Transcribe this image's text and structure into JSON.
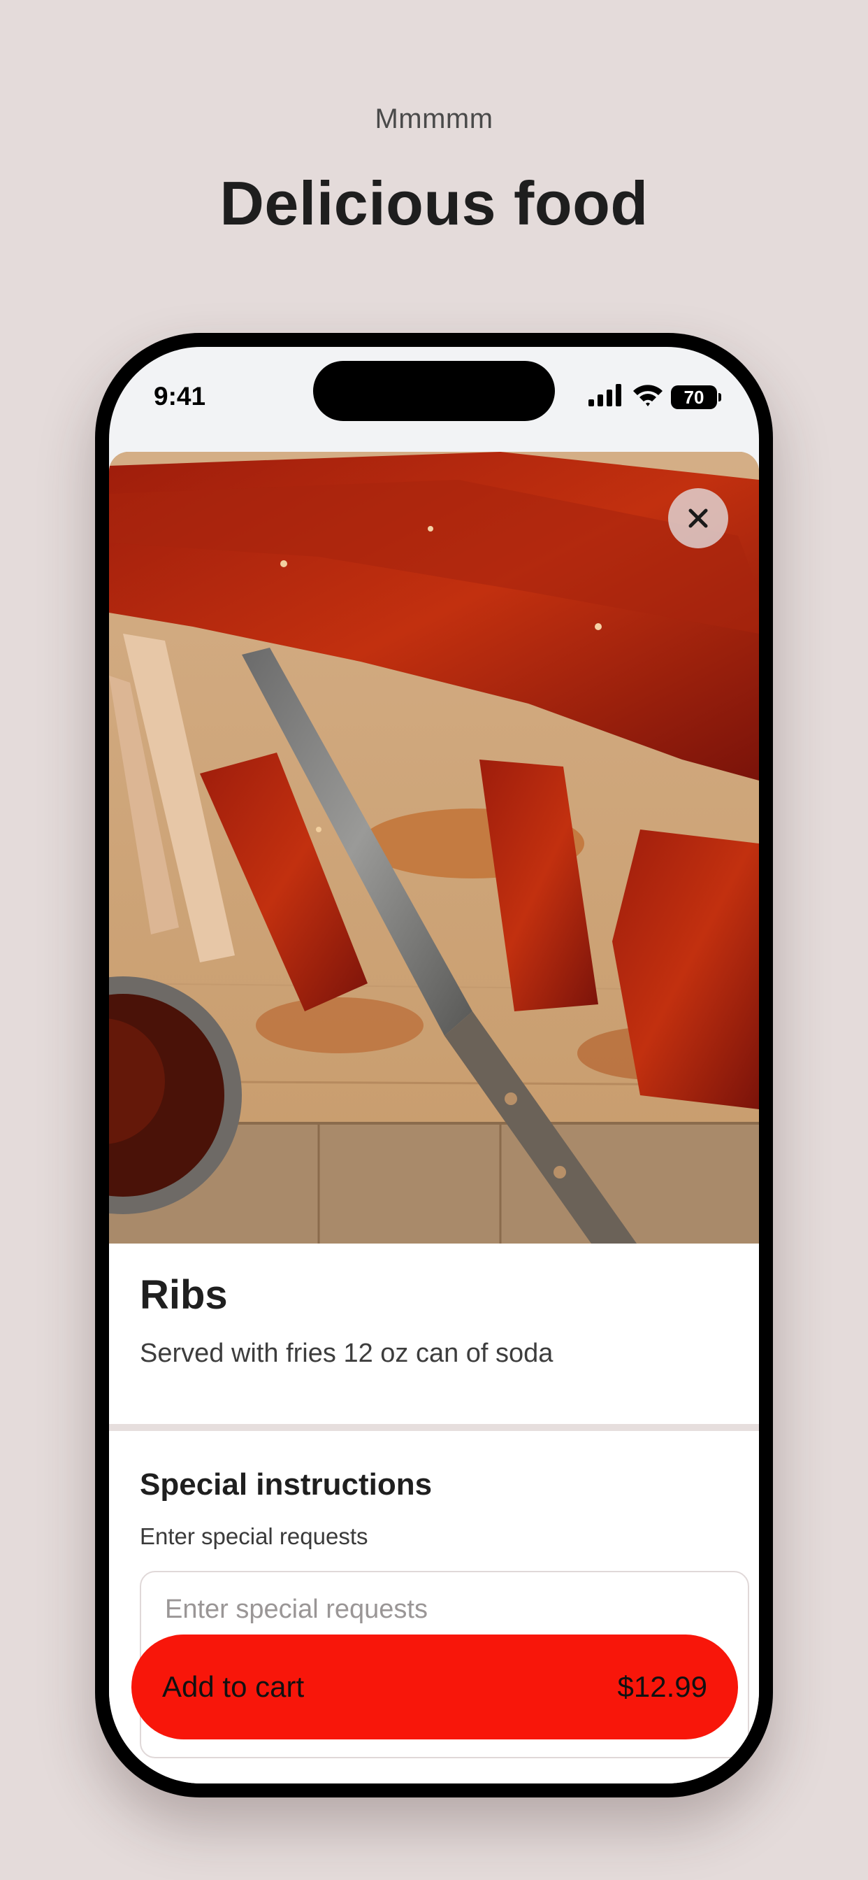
{
  "header": {
    "eyebrow": "Mmmmm",
    "title": "Delicious food"
  },
  "status_bar": {
    "time": "9:41",
    "battery": "70",
    "icons": [
      "cellular-signal-icon",
      "wifi-icon",
      "battery-icon"
    ]
  },
  "item": {
    "image_alt": "ribs-photo",
    "name": "Ribs",
    "description": "Served with fries 12 oz can of soda"
  },
  "instructions": {
    "title": "Special instructions",
    "label": "Enter special requests",
    "placeholder": "Enter special requests"
  },
  "cart": {
    "label": "Add to cart",
    "price": "$12.99",
    "color": "#f8160a"
  },
  "colors": {
    "background": "#e4dbda",
    "accent": "#f8160a"
  }
}
